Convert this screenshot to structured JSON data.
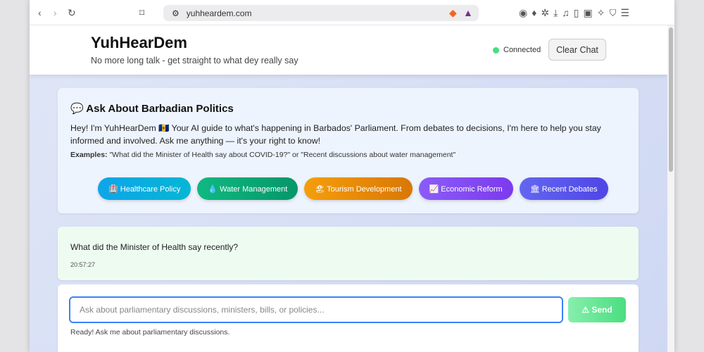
{
  "browser": {
    "url": "yuhheardem.com"
  },
  "header": {
    "title": "YuhHearDem",
    "subtitle": "No more long talk - get straight to what dey really say",
    "status": "Connected",
    "clear_label": "Clear Chat"
  },
  "intro": {
    "heading": "Ask About Barbadian Politics",
    "text": "Hey! I'm YuhHearDem 🇧🇧 Your AI guide to what's happening in Barbados' Parliament. From debates to decisions, I'm here to help you stay informed and involved. Ask me anything — it's your right to know!",
    "examples_label": "Examples:",
    "examples_text": "\"What did the Minister of Health say about COVID-19?\" or \"Recent discussions about water management\"",
    "chips": [
      {
        "label": "🏥 Healthcare Policy",
        "color": "#0ea5e9"
      },
      {
        "label": "💧 Water Management",
        "color": "#10b981"
      },
      {
        "label": "🏖 Tourism Development",
        "color": "#f59e0b"
      },
      {
        "label": "📈 Economic Reform",
        "color": "#8b5cf6"
      },
      {
        "label": "🏛 Recent Debates",
        "color": "#6366f1"
      }
    ]
  },
  "message": {
    "text": "What did the Minister of Health say recently?",
    "time": "20:57:27"
  },
  "input": {
    "placeholder": "Ask about parliamentary discussions, ministers, bills, or policies...",
    "send_label": "⚠ Send",
    "status": "Ready! Ask me about parliamentary discussions."
  }
}
